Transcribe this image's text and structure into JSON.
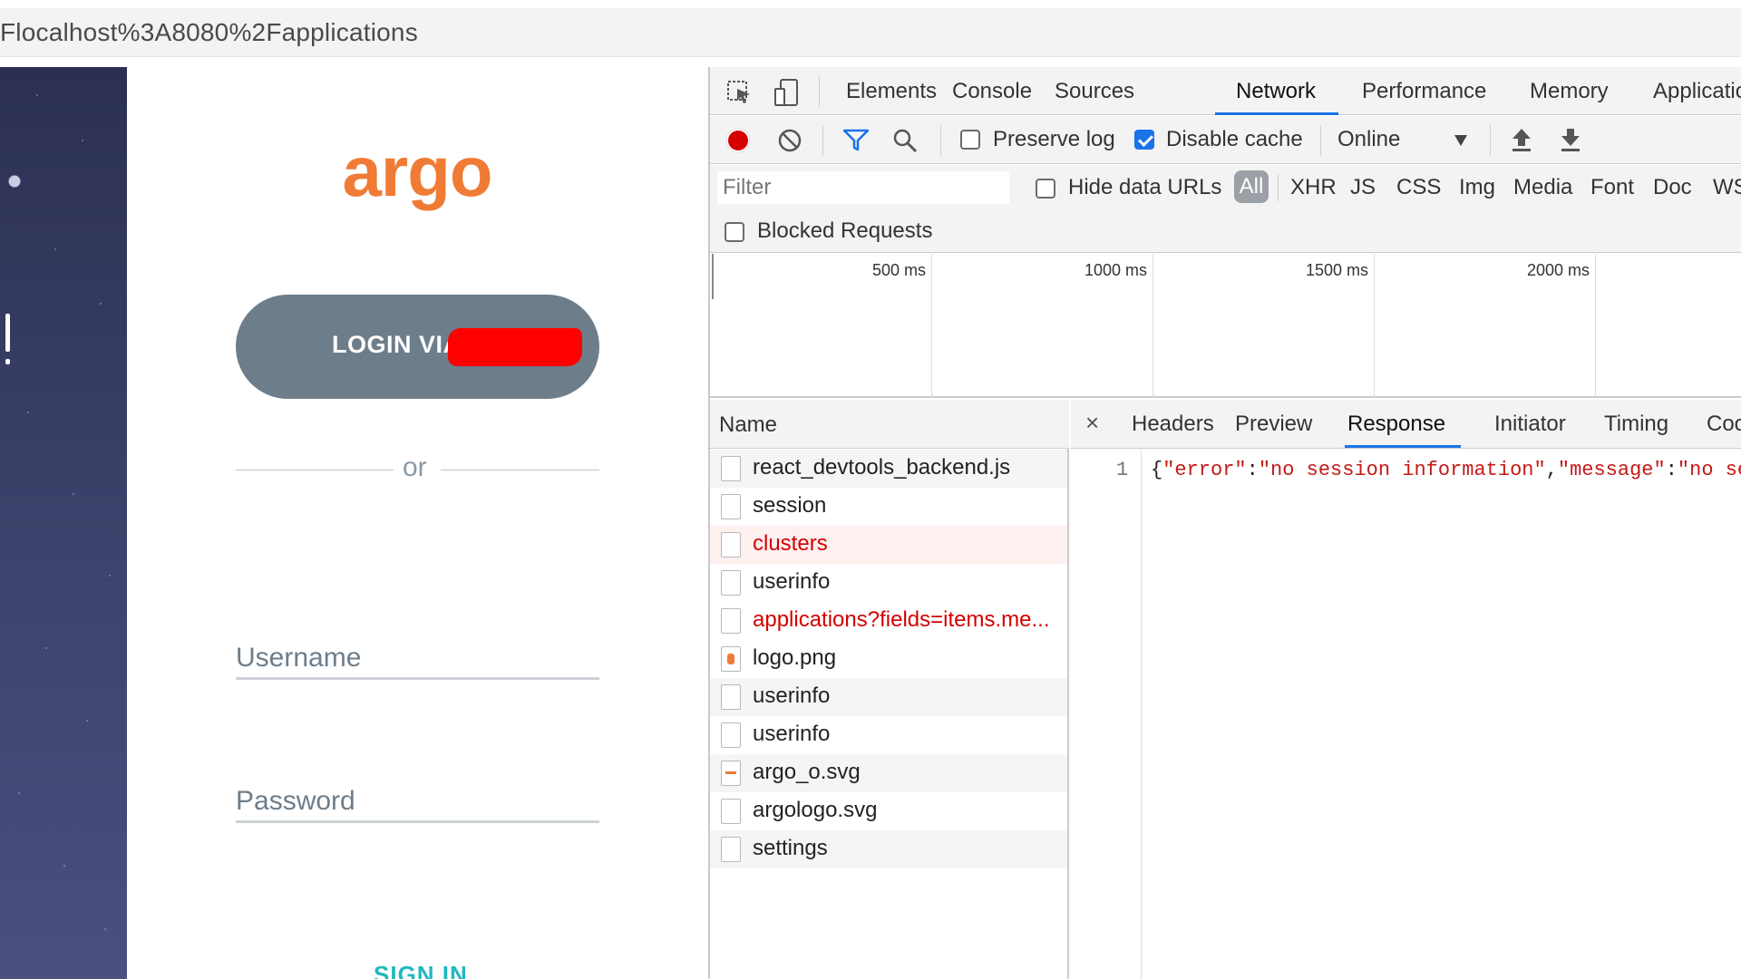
{
  "browser": {
    "url_text": "Flocalhost%3A8080%2Fapplications"
  },
  "login": {
    "logo_text": "argo",
    "sso_label": "LOGIN VIA",
    "divider_text": "or",
    "username_placeholder": "Username",
    "password_placeholder": "Password",
    "signin_label": "SIGN IN",
    "colors": {
      "brand": "#ef7b35",
      "sso_button": "#6d7d8a",
      "signin": "#20b8bf",
      "redaction": "#ff0000"
    }
  },
  "devtools": {
    "tabs": [
      "Elements",
      "Console",
      "Sources",
      "Network",
      "Performance",
      "Memory",
      "Applicatio"
    ],
    "active_tab": "Network",
    "toolbar": {
      "preserve_log": "Preserve log",
      "preserve_log_checked": false,
      "disable_cache": "Disable cache",
      "disable_cache_checked": true,
      "throttle": "Online"
    },
    "filter": {
      "placeholder": "Filter",
      "hide_data_urls": "Hide data URLs",
      "types": [
        "All",
        "XHR",
        "JS",
        "CSS",
        "Img",
        "Media",
        "Font",
        "Doc",
        "WS"
      ],
      "active_type": "All",
      "blocked_requests": "Blocked Requests"
    },
    "timeline": {
      "ticks": [
        "500 ms",
        "1000 ms",
        "1500 ms",
        "2000 ms"
      ]
    },
    "requests": {
      "header": "Name",
      "rows": [
        {
          "name": "react_devtools_backend.js",
          "status": "ok"
        },
        {
          "name": "session",
          "status": "ok"
        },
        {
          "name": "clusters",
          "status": "error"
        },
        {
          "name": "userinfo",
          "status": "ok"
        },
        {
          "name": "applications?fields=items.me...",
          "status": "error"
        },
        {
          "name": "logo.png",
          "status": "ok"
        },
        {
          "name": "userinfo",
          "status": "ok"
        },
        {
          "name": "userinfo",
          "status": "ok"
        },
        {
          "name": "argo_o.svg",
          "status": "ok"
        },
        {
          "name": "argologo.svg",
          "status": "ok"
        },
        {
          "name": "settings",
          "status": "ok"
        }
      ]
    },
    "detail": {
      "close": "×",
      "tabs": [
        "Headers",
        "Preview",
        "Response",
        "Initiator",
        "Timing",
        "Coo"
      ],
      "active_tab": "Response",
      "line_number": "1",
      "response": {
        "open": "{",
        "k1": "\"error\"",
        "colon1": ":",
        "v1": "\"no session information\"",
        "comma": ",",
        "k2": "\"message\"",
        "colon2": ":",
        "v2": "\"no se"
      }
    }
  }
}
